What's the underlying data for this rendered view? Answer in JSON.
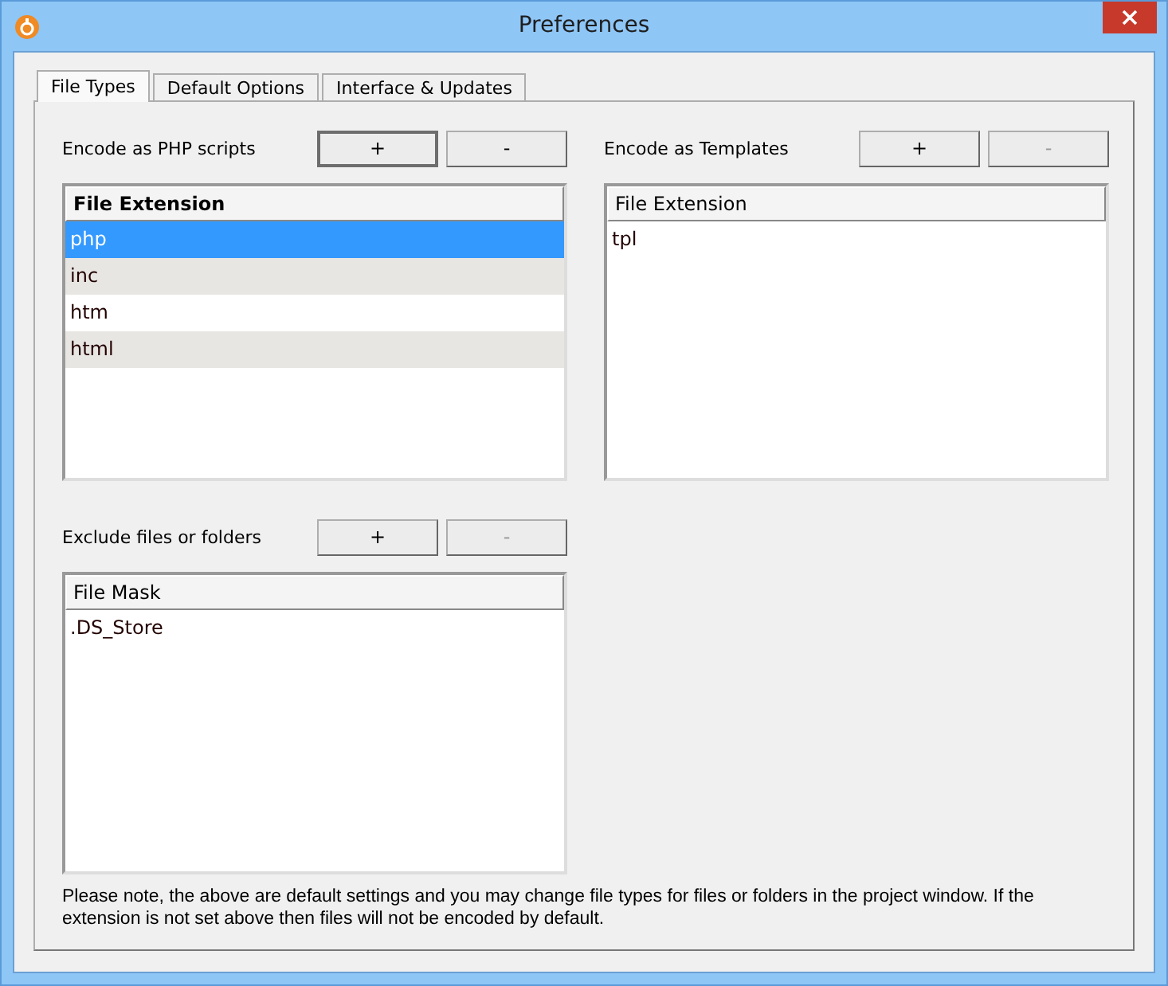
{
  "window": {
    "title": "Preferences"
  },
  "tabs": [
    {
      "label": "File Types",
      "selected": true
    },
    {
      "label": "Default Options",
      "selected": false
    },
    {
      "label": "Interface & Updates",
      "selected": false
    }
  ],
  "sections": [
    {
      "label": "Encode as PHP scripts",
      "buttons": [
        {
          "label": "+",
          "disabled": false
        },
        {
          "label": "-",
          "disabled": false
        }
      ],
      "list": {
        "focused": true,
        "column": "File Extension",
        "rows": [
          {
            "text": "php",
            "selected": true
          },
          {
            "text": "inc",
            "selected": false
          },
          {
            "text": "htm",
            "selected": false
          },
          {
            "text": "html",
            "selected": false
          }
        ]
      }
    },
    {
      "label": "Encode as Templates",
      "buttons": [
        {
          "label": "+",
          "disabled": false
        },
        {
          "label": "-",
          "disabled": true
        }
      ],
      "list": {
        "focused": false,
        "column": "File Extension",
        "rows": [
          {
            "text": "tpl",
            "selected": false
          }
        ]
      }
    },
    {
      "label": "Exclude files or folders",
      "buttons": [
        {
          "label": "+",
          "disabled": false
        },
        {
          "label": "-",
          "disabled": true
        }
      ],
      "list": {
        "focused": false,
        "column": "File Mask",
        "rows": [
          {
            "text": ".DS_Store",
            "selected": false
          }
        ]
      }
    }
  ],
  "note": "Please note, the above are default settings and you may change file types for files or folders in the project window. If the extension is not set above then files will not be encoded by default."
}
